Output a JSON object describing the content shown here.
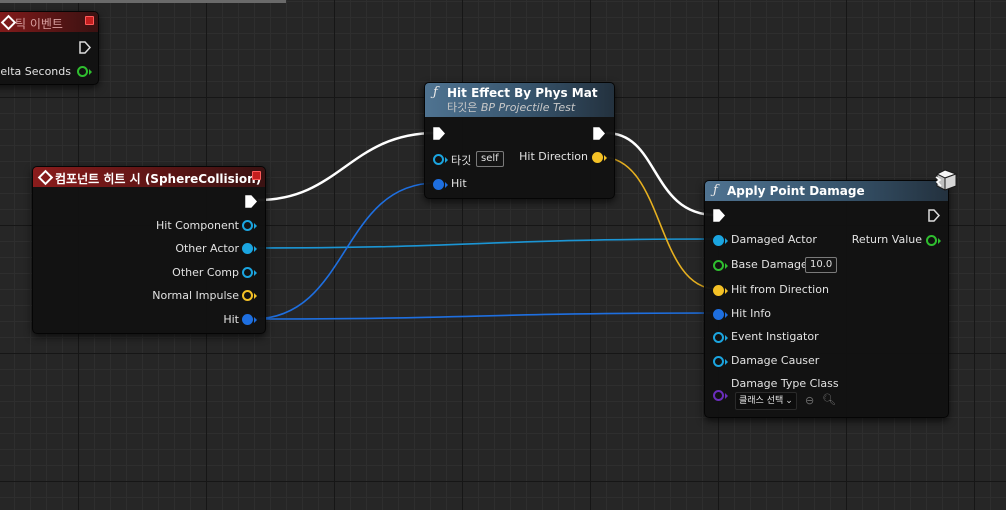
{
  "tick_event": {
    "title": "틱 이벤트",
    "pins": {
      "delta_seconds": "Delta Seconds"
    }
  },
  "component_hit_event": {
    "title": "컴포넌트 히트 시 (SphereCollision)",
    "pins": {
      "hit_component": "Hit Component",
      "other_actor": "Other Actor",
      "other_comp": "Other Comp",
      "normal_impulse": "Normal Impulse",
      "hit": "Hit"
    }
  },
  "hit_effect_node": {
    "title": "Hit Effect By Phys Mat",
    "subtitle_prefix": "타깃은 ",
    "subtitle_target": "BP Projectile Test",
    "pins": {
      "target": "타깃",
      "target_default": "self",
      "hit": "Hit",
      "hit_direction": "Hit Direction"
    }
  },
  "apply_point_damage_node": {
    "title": "Apply Point Damage",
    "pins": {
      "damaged_actor": "Damaged Actor",
      "return_value": "Return Value",
      "base_damage": "Base Damage",
      "base_damage_value": "10.0",
      "hit_from_direction": "Hit from Direction",
      "hit_info": "Hit Info",
      "event_instigator": "Event Instigator",
      "damage_causer": "Damage Causer",
      "damage_type_class": "Damage Type Class",
      "class_select": "클래스 선택"
    }
  },
  "colors": {
    "exec_wire": "#ffffff",
    "object_wire": "#1ba5e0",
    "struct_wire": "#1e6fe0",
    "vector_wire": "#f4c126",
    "float_pin": "#2fbf2f",
    "class_pin": "#6a2dbc",
    "event_header": "#8a1c1c",
    "function_header": "#4f7391"
  }
}
